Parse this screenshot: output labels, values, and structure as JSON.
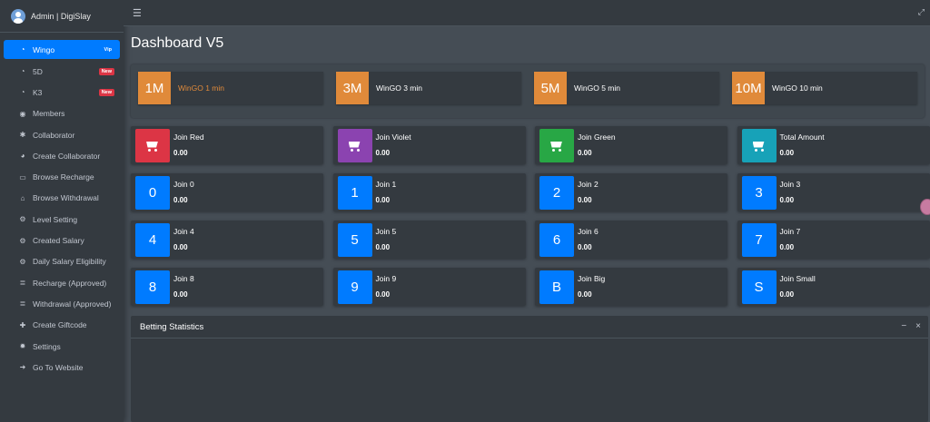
{
  "brand": {
    "user": "Admin | DigiSlay"
  },
  "nav": [
    {
      "label": "Wingo",
      "icon": "gauge-icon",
      "badge": "Vip",
      "active": true
    },
    {
      "label": "5D",
      "icon": "gauge-icon",
      "badge": "New"
    },
    {
      "label": "K3",
      "icon": "gauge-icon",
      "badge": "New"
    },
    {
      "label": "Members",
      "icon": "user-circle-icon"
    },
    {
      "label": "Collaborator",
      "icon": "users-icon"
    },
    {
      "label": "Create Collaborator",
      "icon": "pie-chart-icon"
    },
    {
      "label": "Browse Recharge",
      "icon": "credit-card-icon"
    },
    {
      "label": "Browse Withdrawal",
      "icon": "bank-icon"
    },
    {
      "label": "Level Setting",
      "icon": "cogs-icon"
    },
    {
      "label": "Created Salary",
      "icon": "cogs-icon"
    },
    {
      "label": "Daily Salary Eligibility",
      "icon": "cogs-icon"
    },
    {
      "label": "Recharge (Approved)",
      "icon": "list-icon"
    },
    {
      "label": "Withdrawal (Approved)",
      "icon": "list-icon"
    },
    {
      "label": "Create Giftcode",
      "icon": "gift-icon"
    },
    {
      "label": "Settings",
      "icon": "gear-icon"
    },
    {
      "label": "Go To Website",
      "icon": "sign-out-icon"
    }
  ],
  "page": {
    "title": "Dashboard V5"
  },
  "games": [
    {
      "icon": "1M",
      "label": "WinGO 1 min"
    },
    {
      "icon": "3M",
      "label": "WinGO 3 min"
    },
    {
      "icon": "5M",
      "label": "WinGO 5 min"
    },
    {
      "icon": "10M",
      "label": "WinGO 10 min"
    }
  ],
  "cards": [
    {
      "label": "Join Red",
      "value": "0.00",
      "icon": "cart-icon",
      "color": "#dc3545"
    },
    {
      "label": "Join Violet",
      "value": "0.00",
      "icon": "cart-icon",
      "color": "#8b43b0"
    },
    {
      "label": "Join Green",
      "value": "0.00",
      "icon": "cart-icon",
      "color": "#28a745"
    },
    {
      "label": "Total Amount",
      "value": "0.00",
      "icon": "cart-icon",
      "color": "#17a2b8"
    },
    {
      "label": "Join 0",
      "value": "0.00",
      "icon": "0",
      "color": "#007bff"
    },
    {
      "label": "Join 1",
      "value": "0.00",
      "icon": "1",
      "color": "#007bff"
    },
    {
      "label": "Join 2",
      "value": "0.00",
      "icon": "2",
      "color": "#007bff"
    },
    {
      "label": "Join 3",
      "value": "0.00",
      "icon": "3",
      "color": "#007bff"
    },
    {
      "label": "Join 4",
      "value": "0.00",
      "icon": "4",
      "color": "#007bff"
    },
    {
      "label": "Join 5",
      "value": "0.00",
      "icon": "5",
      "color": "#007bff"
    },
    {
      "label": "Join 6",
      "value": "0.00",
      "icon": "6",
      "color": "#007bff"
    },
    {
      "label": "Join 7",
      "value": "0.00",
      "icon": "7",
      "color": "#007bff"
    },
    {
      "label": "Join 8",
      "value": "0.00",
      "icon": "8",
      "color": "#007bff"
    },
    {
      "label": "Join 9",
      "value": "0.00",
      "icon": "9",
      "color": "#007bff"
    },
    {
      "label": "Join Big",
      "value": "0.00",
      "icon": "B",
      "color": "#007bff"
    },
    {
      "label": "Join Small",
      "value": "0.00",
      "icon": "S",
      "color": "#007bff"
    }
  ],
  "betting": {
    "title": "Betting Statistics",
    "minimize": "−",
    "close": "×"
  },
  "colors": {
    "accent": "#007bff",
    "orange": "#e08a3a",
    "sidebar": "#343a40",
    "content": "#454d55"
  }
}
